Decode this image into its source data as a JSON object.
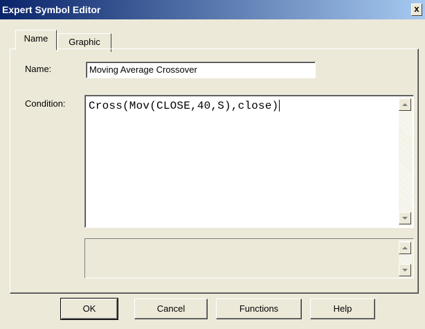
{
  "window": {
    "title": "Expert Symbol Editor",
    "close_label": "x"
  },
  "tabs": [
    {
      "label": "Name",
      "selected": true
    },
    {
      "label": "Graphic",
      "selected": false
    }
  ],
  "form": {
    "name_label": "Name:",
    "name_value": "Moving Average Crossover",
    "condition_label": "Condition:",
    "condition_value": "Cross(Mov(CLOSE,40,S),close)"
  },
  "buttons": {
    "ok": "OK",
    "cancel": "Cancel",
    "functions": "Functions",
    "help": "Help"
  },
  "colors": {
    "titlebar_start": "#0a246a",
    "titlebar_end": "#a6caf0",
    "face": "#ece9d8"
  },
  "icons": {
    "close": "close-icon",
    "scroll_up": "scroll-up-arrow-icon",
    "scroll_down": "scroll-down-arrow-icon"
  }
}
